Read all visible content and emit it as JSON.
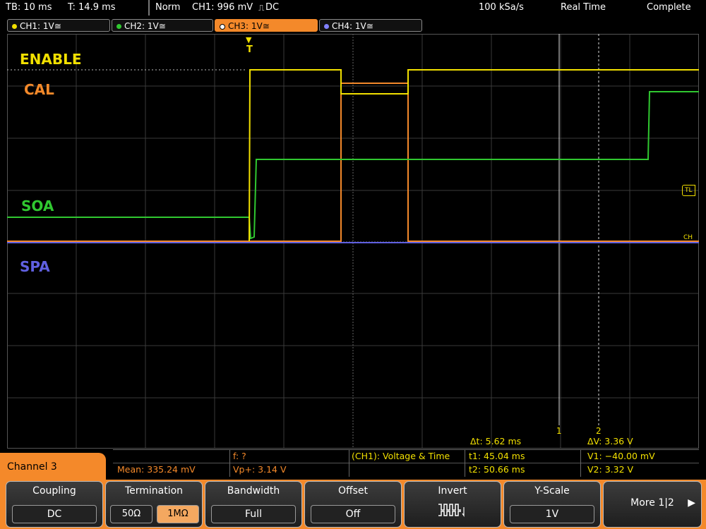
{
  "status_bar": {
    "tb": "TB: 10 ms",
    "trig_time": "T: 14.9 ms",
    "trig_mode": "Norm",
    "trig_source": "CH1: 996 mV",
    "trig_coupling": "DC",
    "sample_rate": "100 kSa/s",
    "acq_mode": "Real Time",
    "acq_status": "Complete"
  },
  "channels": [
    {
      "label": "CH1: 1V",
      "color": "#f2e000"
    },
    {
      "label": "CH2: 1V",
      "color": "#30c830"
    },
    {
      "label": "CH3: 1V",
      "color": "#f4892a"
    },
    {
      "label": "CH4: 1V",
      "color": "#6060e0"
    }
  ],
  "coupling_glyph": "≅",
  "trace_labels": {
    "enable": "ENABLE",
    "cal": "CAL",
    "soa": "SOA",
    "spa": "SPA"
  },
  "markers": {
    "trigger": "T",
    "trigger_level": "TL",
    "cursor1": "1",
    "cursor2": "2",
    "ch_ref": "CH"
  },
  "measurements": {
    "mean": "Mean: 335.24 mV",
    "freq": "f: ?",
    "vp": "Vp+: 3.14 V",
    "cursor_title": "(CH1): Voltage & Time",
    "dt": "Δt: 5.62 ms",
    "t1": "t1: 45.04 ms",
    "t2": "t2: 50.66 ms",
    "dv": "ΔV: 3.36 V",
    "v1": "V1: −40.00 mV",
    "v2": "V2: 3.32 V"
  },
  "channel_menu": {
    "title": "Channel 3",
    "coupling_label": "Coupling",
    "coupling_value": "DC",
    "termination_label": "Termination",
    "termination_opt1": "50Ω",
    "termination_opt2": "1MΩ",
    "bandwidth_label": "Bandwidth",
    "bandwidth_value": "Full",
    "offset_label": "Offset",
    "offset_value": "Off",
    "invert_label": "Invert",
    "yscale_label": "Y-Scale",
    "yscale_value": "1V",
    "more_label": "More 1|2"
  },
  "colors": {
    "ch1": "#f2e000",
    "ch2": "#30c830",
    "ch3": "#f4892a",
    "ch4": "#6060e0",
    "accent": "#f4892a"
  }
}
